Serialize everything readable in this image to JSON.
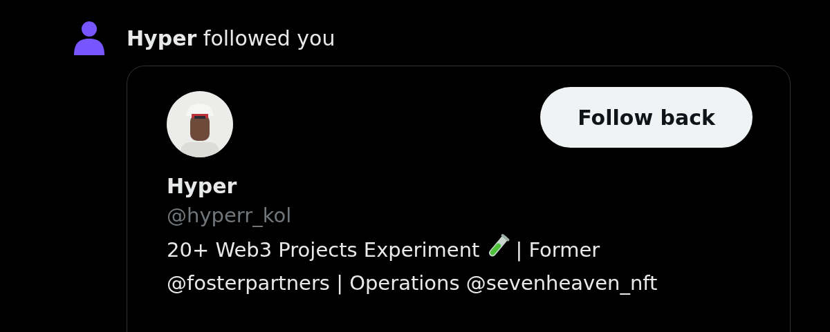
{
  "notification": {
    "actor": "Hyper",
    "action": "followed you"
  },
  "card": {
    "button": "Follow back",
    "name": "Hyper",
    "handle": "@hyperr_kol",
    "bio": [
      {
        "kind": "text",
        "text": "20+ Web3 Projects Experiment"
      },
      {
        "kind": "test-tube"
      },
      {
        "kind": "text",
        "text": "| Former"
      },
      {
        "kind": "break"
      },
      {
        "kind": "text",
        "text": "@fosterpartners | Operations @sevenheaven_nft"
      }
    ]
  }
}
